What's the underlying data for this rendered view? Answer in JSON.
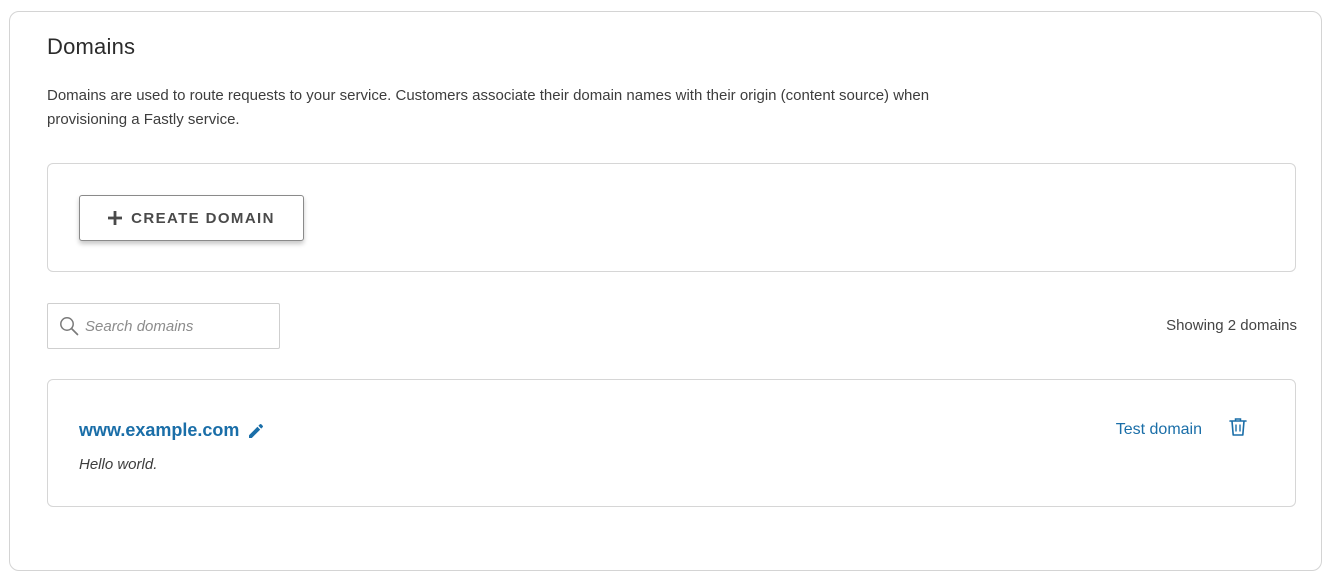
{
  "section": {
    "title": "Domains",
    "description": "Domains are used to route requests to your service. Customers associate their domain names with their origin (content source) when provisioning a Fastly service."
  },
  "toolbar": {
    "create_label": "CREATE DOMAIN",
    "create_icon": "plus-icon"
  },
  "search": {
    "placeholder": "Search domains",
    "value": "",
    "icon": "search-icon"
  },
  "summary": {
    "count_text": "Showing 2 domains"
  },
  "domains": [
    {
      "name": "www.example.com",
      "comment": "Hello world.",
      "test_label": "Test domain",
      "edit_icon": "pencil-icon",
      "delete_icon": "trash-icon"
    }
  ],
  "colors": {
    "link": "#1a6ea8",
    "border": "#d6d6d6",
    "text": "#333333"
  }
}
